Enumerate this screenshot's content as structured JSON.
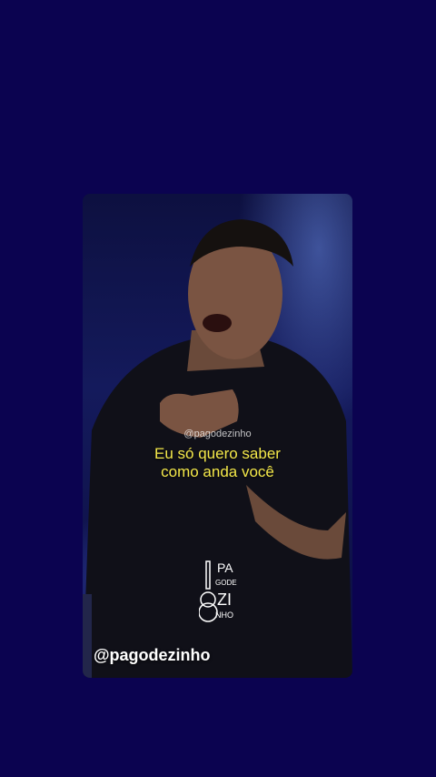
{
  "video": {
    "watermark": "@pagodezinho",
    "lyrics_line1": "Eu só quero saber",
    "lyrics_line2": "como anda você",
    "handle": "@pagodezinho",
    "logo_text": {
      "line1": "PA",
      "line2": "GODE",
      "line3": "ZI",
      "line4": "NHO"
    }
  },
  "colors": {
    "background": "#0b0350",
    "lyrics": "#f4e84a"
  }
}
